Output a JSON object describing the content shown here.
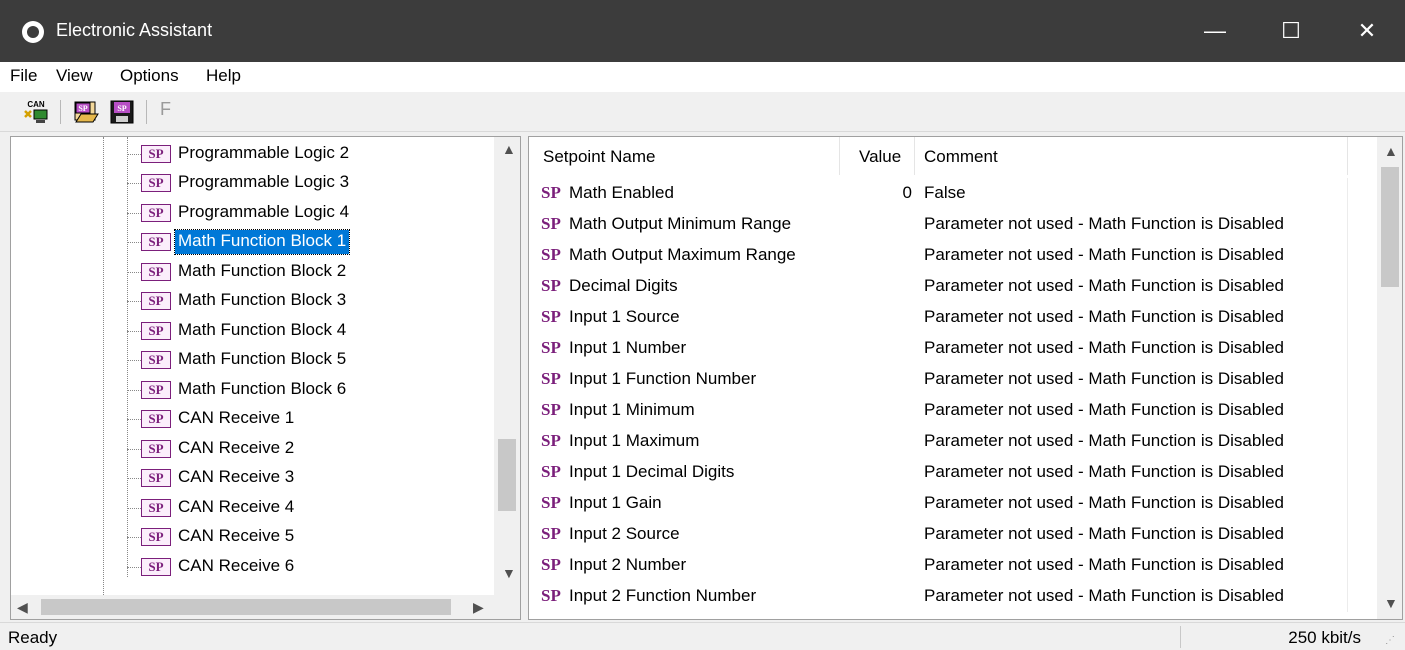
{
  "window": {
    "title": "Electronic Assistant",
    "minimize_glyph": "—",
    "maximize_glyph": "☐",
    "close_glyph": "✕"
  },
  "menu": [
    "File",
    "View",
    "Options",
    "Help"
  ],
  "toolbar": {
    "buttons": [
      "can-connect-icon",
      "sp-open-icon",
      "sp-save-icon"
    ],
    "can_label": "CAN",
    "sp_label": "SP",
    "f_label": "F"
  },
  "tree": {
    "icon_label": "SP",
    "items": [
      {
        "label": "Programmable Logic 2",
        "selected": false
      },
      {
        "label": "Programmable Logic 3",
        "selected": false
      },
      {
        "label": "Programmable Logic 4",
        "selected": false
      },
      {
        "label": "Math Function Block 1",
        "selected": true
      },
      {
        "label": "Math Function Block 2",
        "selected": false
      },
      {
        "label": "Math Function Block 3",
        "selected": false
      },
      {
        "label": "Math Function Block 4",
        "selected": false
      },
      {
        "label": "Math Function Block 5",
        "selected": false
      },
      {
        "label": "Math Function Block 6",
        "selected": false
      },
      {
        "label": "CAN Receive 1",
        "selected": false
      },
      {
        "label": "CAN Receive 2",
        "selected": false
      },
      {
        "label": "CAN Receive 3",
        "selected": false
      },
      {
        "label": "CAN Receive 4",
        "selected": false
      },
      {
        "label": "CAN Receive 5",
        "selected": false
      },
      {
        "label": "CAN Receive 6",
        "selected": false
      }
    ]
  },
  "list": {
    "columns": [
      "Setpoint Name",
      "Value",
      "Comment"
    ],
    "sp_label": "SP",
    "rows": [
      {
        "name": "Math Enabled",
        "value": "0",
        "comment": "False"
      },
      {
        "name": "Math Output Minimum Range",
        "value": "",
        "comment": "Parameter not used - Math Function is Disabled"
      },
      {
        "name": "Math Output Maximum Range",
        "value": "",
        "comment": "Parameter not used - Math Function is Disabled"
      },
      {
        "name": "Decimal Digits",
        "value": "",
        "comment": "Parameter not used - Math Function is Disabled"
      },
      {
        "name": "Input 1 Source",
        "value": "",
        "comment": "Parameter not used - Math Function is Disabled"
      },
      {
        "name": "Input 1 Number",
        "value": "",
        "comment": "Parameter not used - Math Function is Disabled"
      },
      {
        "name": "Input 1 Function Number",
        "value": "",
        "comment": "Parameter not used - Math Function is Disabled"
      },
      {
        "name": "Input 1 Minimum",
        "value": "",
        "comment": "Parameter not used - Math Function is Disabled"
      },
      {
        "name": "Input 1 Maximum",
        "value": "",
        "comment": "Parameter not used - Math Function is Disabled"
      },
      {
        "name": "Input 1 Decimal Digits",
        "value": "",
        "comment": "Parameter not used - Math Function is Disabled"
      },
      {
        "name": "Input 1 Gain",
        "value": "",
        "comment": "Parameter not used - Math Function is Disabled"
      },
      {
        "name": "Input 2 Source",
        "value": "",
        "comment": "Parameter not used - Math Function is Disabled"
      },
      {
        "name": "Input 2 Number",
        "value": "",
        "comment": "Parameter not used - Math Function is Disabled"
      },
      {
        "name": "Input 2 Function Number",
        "value": "",
        "comment": "Parameter not used - Math Function is Disabled"
      }
    ]
  },
  "status": {
    "text": "Ready",
    "bitrate": "250 kbit/s"
  },
  "colors": {
    "titlebar": "#3c3c3c",
    "selection": "#0078d7",
    "sp_accent": "#7b1f7b"
  }
}
